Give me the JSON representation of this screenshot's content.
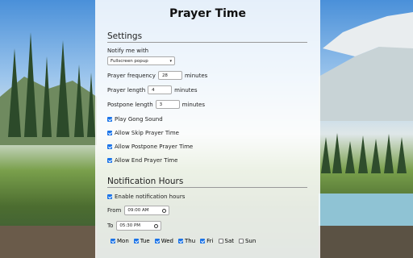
{
  "title": "Prayer Time",
  "settings": {
    "heading": "Settings",
    "notify_label": "Notify me with",
    "notify_value": "Fullscreen popup",
    "frequency_label": "Prayer frequency",
    "frequency_value": "28",
    "frequency_unit": "minutes",
    "length_label": "Prayer length",
    "length_value": "4",
    "length_unit": "minutes",
    "postpone_label": "Postpone length",
    "postpone_value": "3",
    "postpone_unit": "minutes",
    "checkboxes": [
      {
        "label": "Play Gong Sound",
        "checked": true
      },
      {
        "label": "Allow Skip Prayer Time",
        "checked": true
      },
      {
        "label": "Allow Postpone Prayer Time",
        "checked": true
      },
      {
        "label": "Allow End Prayer Time",
        "checked": true
      }
    ]
  },
  "hours": {
    "heading": "Notification Hours",
    "enable_label": "Enable notification hours",
    "enable_checked": true,
    "from_label": "From",
    "from_value": "09:00 AM",
    "to_label": "To",
    "to_value": "05:30 PM",
    "days": [
      {
        "label": "Mon",
        "checked": true
      },
      {
        "label": "Tue",
        "checked": true
      },
      {
        "label": "Wed",
        "checked": true
      },
      {
        "label": "Thu",
        "checked": true
      },
      {
        "label": "Fri",
        "checked": true
      },
      {
        "label": "Sat",
        "checked": false
      },
      {
        "label": "Sun",
        "checked": false
      }
    ]
  },
  "colors": {
    "accent": "#1a73e8"
  },
  "icons": {
    "dropdown": "chevron-down-icon",
    "time": "clock-icon"
  }
}
